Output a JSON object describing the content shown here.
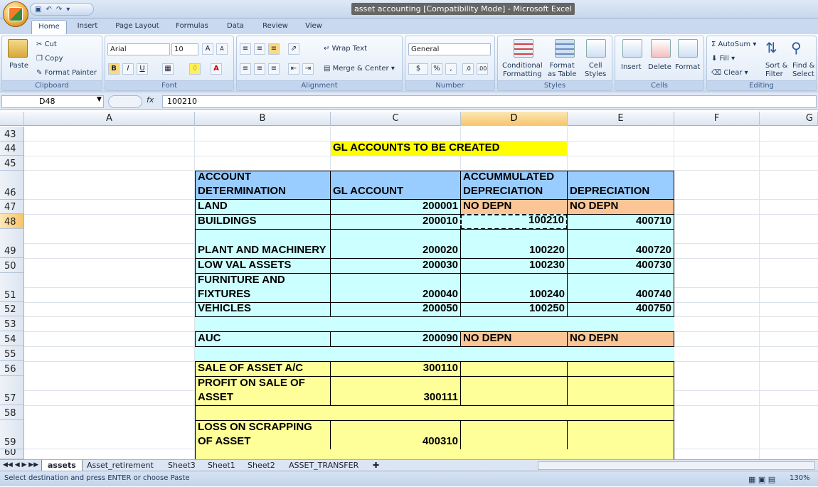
{
  "window": {
    "title": "asset accounting  [Compatibility Mode] - Microsoft Excel"
  },
  "tabs": [
    "Home",
    "Insert",
    "Page Layout",
    "Formulas",
    "Data",
    "Review",
    "View"
  ],
  "ribbon": {
    "clipboard": {
      "label": "Clipboard",
      "paste": "Paste",
      "cut": "Cut",
      "copy": "Copy",
      "format_painter": "Format Painter"
    },
    "font": {
      "label": "Font",
      "name": "Arial",
      "size": "10",
      "bold": "B",
      "italic": "I",
      "underline": "U"
    },
    "alignment": {
      "label": "Alignment",
      "wrap_text": "Wrap Text",
      "merge_center": "Merge & Center"
    },
    "number": {
      "label": "Number",
      "format": "General",
      "currency": "$",
      "percent": "%",
      "comma": ","
    },
    "styles": {
      "label": "Styles",
      "conditional": "Conditional\nFormatting",
      "format_table": "Format\nas Table",
      "cell_styles": "Cell\nStyles"
    },
    "cells": {
      "label": "Cells",
      "insert": "Insert",
      "delete": "Delete",
      "format": "Format"
    },
    "editing": {
      "label": "Editing",
      "autosum": "AutoSum",
      "fill": "Fill",
      "clear": "Clear",
      "sort_filter": "Sort &\nFilter",
      "find_select": "Find &\nSelect"
    }
  },
  "formula_bar": {
    "name_box": "D48",
    "fx": "fx",
    "content": "100210"
  },
  "columns": [
    "A",
    "B",
    "C",
    "D",
    "E",
    "F",
    "G"
  ],
  "rows": [
    "43",
    "44",
    "45",
    "46",
    "47",
    "48",
    "49",
    "50",
    "51",
    "52",
    "53",
    "54",
    "55",
    "56",
    "57",
    "58",
    "59",
    "60"
  ],
  "cells": {
    "title": "GL ACCOUNTS TO BE CREATED",
    "h_b": "ACCOUNT\nDETERMINATION",
    "h_c": "GL ACCOUNT",
    "h_d": "ACCUMMULATED\nDEPRECIATION",
    "h_e": "DEPRECIATION",
    "b47": "LAND",
    "c47": "200001",
    "d47": "NO DEPN",
    "e47": "NO DEPN",
    "b48": "BUILDINGS",
    "c48": "200010",
    "d48": "100210",
    "e48": "400710",
    "b49": "PLANT AND MACHINERY",
    "c49": "200020",
    "d49": "100220",
    "e49": "400720",
    "b50": "LOW VAL ASSETS",
    "c50": "200030",
    "d50": "100230",
    "e50": "400730",
    "b51": "FURNITURE AND\nFIXTURES",
    "c51": "200040",
    "d51": "100240",
    "e51": "400740",
    "b52": "VEHICLES",
    "c52": "200050",
    "d52": "100250",
    "e52": "400750",
    "b54": "AUC",
    "c54": "200090",
    "d54": "NO DEPN",
    "e54": "NO DEPN",
    "b56": "SALE OF ASSET A/C",
    "c56": "300110",
    "b57": "PROFIT ON SALE OF\nASSET",
    "c57": "300111",
    "b59": "LOSS ON SCRAPPING\nOF ASSET",
    "c59": "400310"
  },
  "sheets": [
    "assets",
    "Asset_retirement",
    "Sheet3",
    "Sheet1",
    "Sheet2",
    "ASSET_TRANSFER"
  ],
  "status": {
    "message": "Select destination and press ENTER or choose Paste",
    "zoom": "130%"
  }
}
